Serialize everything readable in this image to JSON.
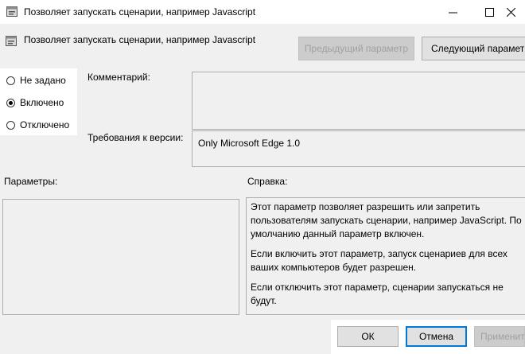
{
  "window": {
    "title": "Позволяет запускать сценарии, например Javascript",
    "icon": "policy-settings-icon"
  },
  "header": {
    "setting_name": "Позволяет запускать сценарии, например Javascript",
    "prev_button": "Предыдущий параметр",
    "next_button": "Следующий параметр"
  },
  "state_options": [
    {
      "label": "Не задано",
      "checked": false
    },
    {
      "label": "Включено",
      "checked": true
    },
    {
      "label": "Отключено",
      "checked": false
    }
  ],
  "comment": {
    "label": "Комментарий:",
    "value": ""
  },
  "supported": {
    "label": "Требования к версии:",
    "value": "Only Microsoft Edge 1.0"
  },
  "options": {
    "label": "Параметры:"
  },
  "help": {
    "label": "Справка:",
    "paragraphs": [
      "Этот параметр позволяет разрешить или запретить пользователям запускать сценарии, например JavaScript. По умолчанию данный параметр включен.",
      "Если включить этот параметр, запуск сценариев для всех ваших компьютеров будет разрешен.",
      "Если отключить этот параметр, сценарии запускаться не будут."
    ]
  },
  "footer": {
    "ok": "ОК",
    "cancel": "Отмена",
    "apply": "Применить"
  },
  "colors": {
    "accent": "#0078d7",
    "window_bg": "#f0f0f0",
    "disabled_text": "#a0a0a0"
  }
}
